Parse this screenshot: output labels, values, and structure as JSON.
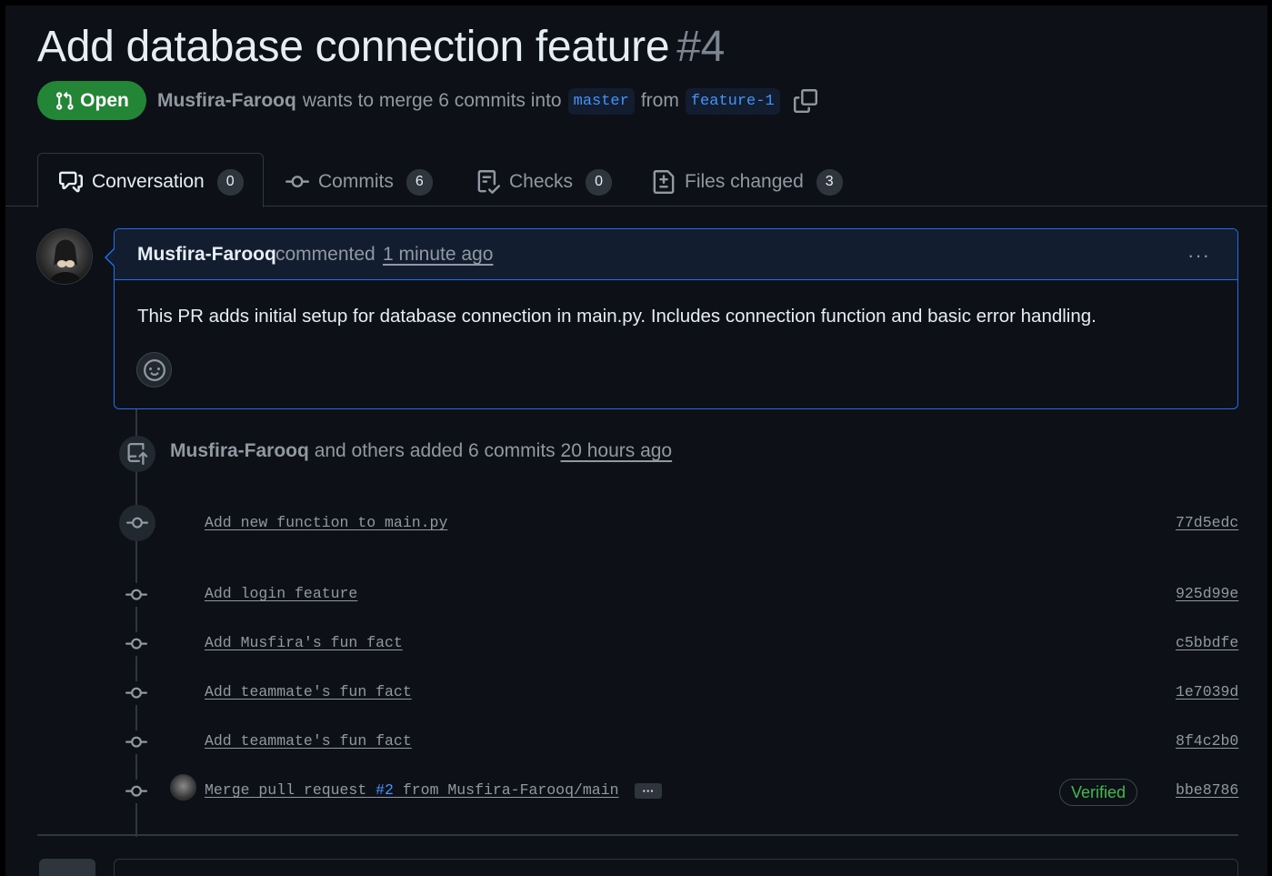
{
  "pr": {
    "title": "Add database connection feature",
    "number": "#4",
    "state": "Open",
    "author": "Musfira-Farooq",
    "merge_text": "wants to merge 6 commits into",
    "base_branch": "master",
    "from_text": "from",
    "head_branch": "feature-1"
  },
  "tabs": [
    {
      "label": "Conversation",
      "count": "0"
    },
    {
      "label": "Commits",
      "count": "6"
    },
    {
      "label": "Checks",
      "count": "0"
    },
    {
      "label": "Files changed",
      "count": "3"
    }
  ],
  "comment": {
    "author": "Musfira-Farooq",
    "action": "commented",
    "time": "1 minute ago",
    "menu": "···",
    "body": "This PR adds initial setup for database connection in main.py. Includes connection function and basic error handling."
  },
  "push_event": {
    "author": "Musfira-Farooq",
    "text": "and others added 6 commits",
    "time": "20 hours ago"
  },
  "commits": [
    {
      "message": "Add new function to main.py",
      "sha": "77d5edc"
    },
    {
      "message": "Add login feature",
      "sha": "925d99e"
    },
    {
      "message": "Add Musfira's fun fact",
      "sha": "c5bbdfe"
    },
    {
      "message": "Add teammate's fun fact",
      "sha": "1e7039d"
    },
    {
      "message": "Add teammate's fun fact",
      "sha": "8f4c2b0"
    },
    {
      "message_pre": "Merge pull request",
      "message_pr": "#2",
      "message_post": "from Musfira-Farooq/main",
      "more": "···",
      "verified": "Verified",
      "sha": "bbe8786"
    }
  ],
  "colors": {
    "background": "#0d1117",
    "open_green": "#238636",
    "accent_blue": "#1f6feb",
    "link_blue": "#4493f8",
    "verified_green": "#3fb950"
  },
  "icons": [
    "git-pull-request-icon",
    "copy-icon",
    "comment-discussion-icon",
    "git-commit-icon",
    "checklist-icon",
    "file-diff-icon",
    "smiley-icon",
    "repo-push-icon",
    "kebab-horizontal-icon"
  ]
}
